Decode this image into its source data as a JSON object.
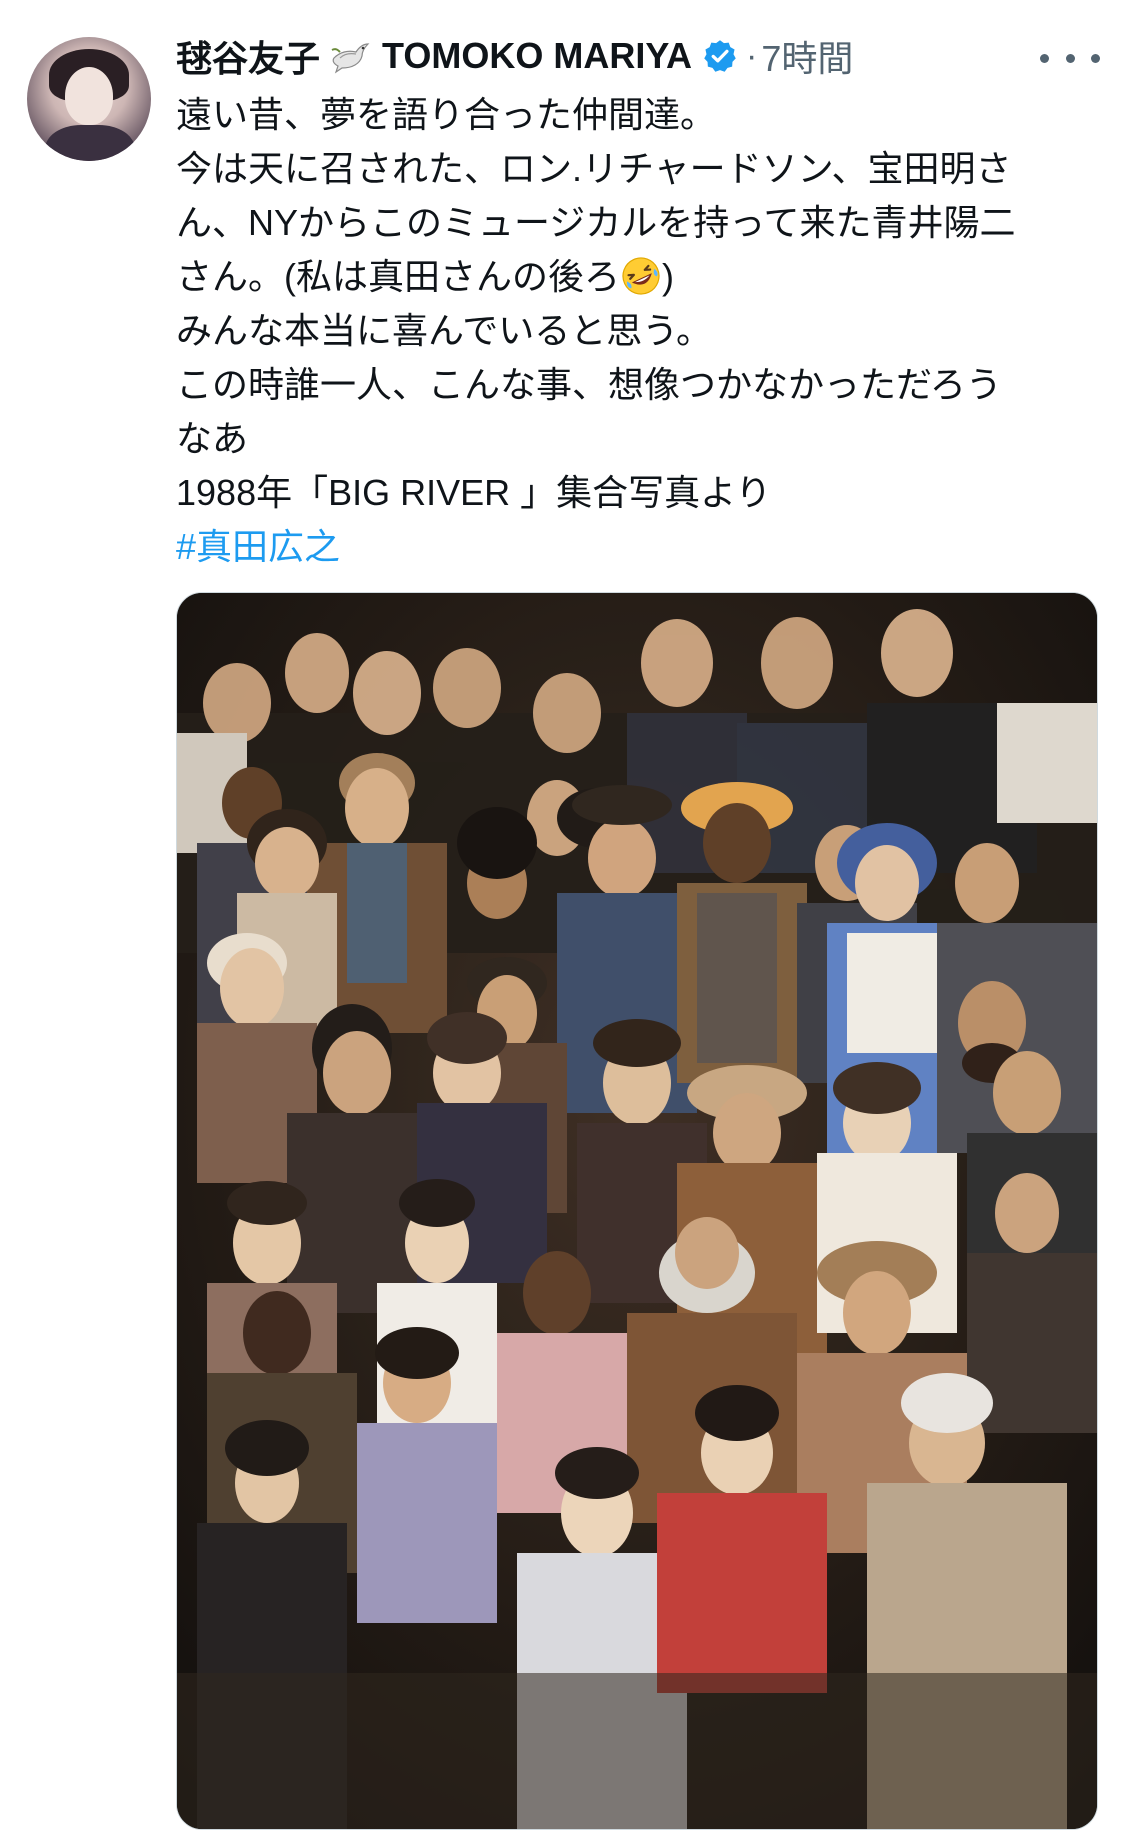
{
  "tweet": {
    "display_name": "毬谷友子",
    "handle_name": "TOMOKO MARIYA",
    "separator": "·",
    "timestamp": "7時間",
    "icons": {
      "dove": "dove-icon",
      "verified": "verified-badge-icon",
      "more": "more-options-icon",
      "emoji": "rolling-on-floor-laughing-emoji"
    },
    "text_lines": [
      "遠い昔、夢を語り合った仲間達。",
      "今は天に召された、ロン.リチャードソン、宝田明さ",
      "ん、NYからこのミュージカルを持って来た青井陽二",
      "さん。(私は真田さんの後ろ",
      ")",
      "みんな本当に喜んでいると思う。",
      "この時誰一人、こんな事、想像つかなかっただろう",
      "なあ",
      "1988年「BIG RIVER 」集合写真より"
    ],
    "hashtag": "#真田広之",
    "colors": {
      "text": "#0f1419",
      "secondary": "#536471",
      "link": "#1d9bf0",
      "verified": "#1d9bf0"
    }
  }
}
